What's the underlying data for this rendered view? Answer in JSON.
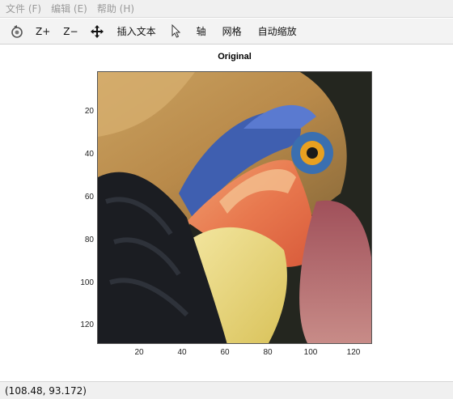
{
  "menubar": {
    "items": [
      {
        "label": "文件 (F)"
      },
      {
        "label": "编辑 (E)"
      },
      {
        "label": "帮助 (H)"
      }
    ]
  },
  "toolbar": {
    "reset_icon": "rotate-reset-icon",
    "zoom_in_label": "Z+",
    "zoom_out_label": "Z−",
    "pan_icon": "move-arrows-icon",
    "insert_text_label": "插入文本",
    "pointer_icon": "cursor-pointer-icon",
    "axis_label": "轴",
    "grid_label": "网格",
    "autoscale_label": "自动缩放"
  },
  "figure": {
    "title": "Original",
    "x_ticks": [
      "20",
      "40",
      "60",
      "80",
      "100",
      "120"
    ],
    "y_ticks": [
      "20",
      "40",
      "60",
      "80",
      "100",
      "120"
    ],
    "x_range": [
      0.5,
      128.5
    ],
    "y_range": [
      0.5,
      128.5
    ],
    "image_description_hidden": ""
  },
  "status": {
    "coordinates": "(108.48, 93.172)"
  }
}
